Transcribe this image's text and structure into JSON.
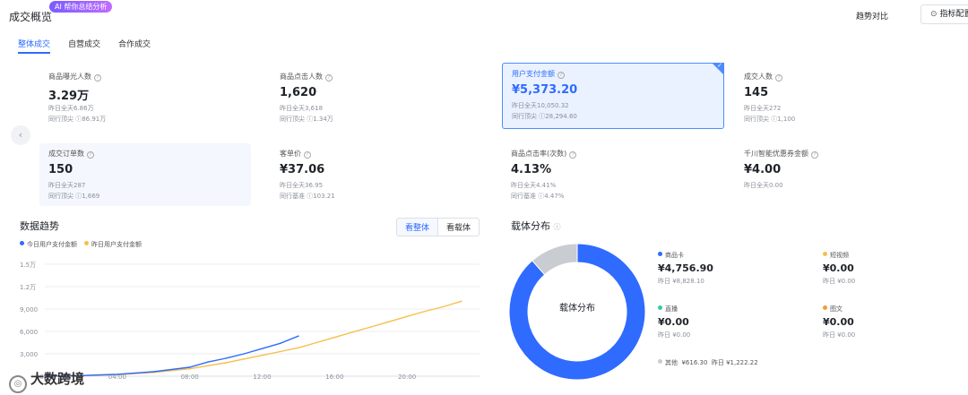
{
  "header": {
    "title": "成交概览",
    "ai_tag": "AI 帮你总结分析",
    "compare_label": "趋势对比",
    "config_label": "指标配置"
  },
  "tabs": [
    {
      "label": "整体成交",
      "active": true
    },
    {
      "label": "自营成交",
      "active": false
    },
    {
      "label": "合作成交",
      "active": false
    }
  ],
  "metrics": [
    {
      "label": "商品曝光人数",
      "value": "3.29万",
      "sub1": "昨日全天6.86万",
      "sub2": "同行顶尖 ⓘ86.91万"
    },
    {
      "label": "商品点击人数",
      "value": "1,620",
      "sub1": "昨日全天3,618",
      "sub2": "同行顶尖 ⓘ1.34万"
    },
    {
      "label": "用户支付金额",
      "value": "¥5,373.20",
      "sub1": "昨日全天10,050.32",
      "sub2": "同行顶尖 ⓘ28,294.60",
      "selected": true
    },
    {
      "label": "成交人数",
      "value": "145",
      "sub1": "昨日全天272",
      "sub2": "同行顶尖 ⓘ1,100"
    },
    {
      "label": "成交订单数",
      "value": "150",
      "sub1": "昨日全天287",
      "sub2": "同行顶尖 ⓘ1,669"
    },
    {
      "label": "客单价",
      "value": "¥37.06",
      "sub1": "昨日全天36.95",
      "sub2": "同行基准 ⓘ103.21"
    },
    {
      "label": "商品点击率(次数)",
      "value": "4.13%",
      "sub1": "昨日全天4.41%",
      "sub2": "同行基准 ⓘ4.47%"
    },
    {
      "label": "千川智能优惠券金额",
      "value": "¥4.00",
      "sub1": "昨日全天0.00",
      "sub2": ""
    }
  ],
  "trend": {
    "title": "数据趋势",
    "toggle": [
      "看整体",
      "看载体"
    ],
    "legend": [
      {
        "name": "今日用户支付金额",
        "color": "#2f6bff"
      },
      {
        "name": "昨日用户支付金额",
        "color": "#f5c04a"
      }
    ]
  },
  "chart_data": [
    {
      "type": "line",
      "title": "",
      "xlabel": "",
      "ylabel": "",
      "x_ticks": [
        "00:00",
        "04:00",
        "08:00",
        "12:00",
        "16:00",
        "20:00"
      ],
      "y_ticks": [
        "3,000",
        "6,000",
        "9,000",
        "1.2万",
        "1.5万"
      ],
      "ylim": [
        0,
        15000
      ],
      "series": [
        {
          "name": "今日用户支付金额",
          "color": "#2f6bff",
          "x": [
            0,
            2,
            4,
            6,
            8,
            9,
            10,
            11,
            12,
            13,
            14
          ],
          "y": [
            0,
            80,
            250,
            600,
            1200,
            1900,
            2400,
            3000,
            3700,
            4400,
            5373
          ]
        },
        {
          "name": "昨日用户支付金额",
          "color": "#f5c04a",
          "x": [
            0,
            2,
            4,
            6,
            8,
            9,
            10,
            11,
            12,
            13,
            14,
            15,
            16,
            17,
            18,
            19,
            20,
            21,
            22,
            23
          ],
          "y": [
            0,
            70,
            200,
            500,
            1000,
            1400,
            1800,
            2300,
            2800,
            3300,
            3800,
            4500,
            5200,
            5900,
            6600,
            7300,
            8000,
            8700,
            9300,
            10050
          ]
        }
      ]
    },
    {
      "type": "pie",
      "title": "载体分布",
      "center_label": "载体分布",
      "slices": [
        {
          "name": "商品卡",
          "value": 4756.9,
          "color": "#2f6bff"
        },
        {
          "name": "其他",
          "value": 616.3,
          "color": "#c9ccd1"
        }
      ]
    }
  ],
  "carrier": {
    "title": "载体分布",
    "items": [
      {
        "name": "商品卡",
        "color": "#2f6bff",
        "amount": "¥4,756.90",
        "yesterday": "昨日 ¥8,828.10"
      },
      {
        "name": "短视频",
        "color": "#f5c04a",
        "amount": "¥0.00",
        "yesterday": "昨日 ¥0.00"
      },
      {
        "name": "直播",
        "color": "#37c9a5",
        "amount": "¥0.00",
        "yesterday": "昨日 ¥0.00"
      },
      {
        "name": "图文",
        "color": "#f59a3c",
        "amount": "¥0.00",
        "yesterday": "昨日 ¥0.00"
      }
    ],
    "other": {
      "name": "其他",
      "amount": "¥616.30",
      "yesterday": "昨日 ¥1,222.22"
    }
  },
  "brand": {
    "text": "大数跨境"
  }
}
